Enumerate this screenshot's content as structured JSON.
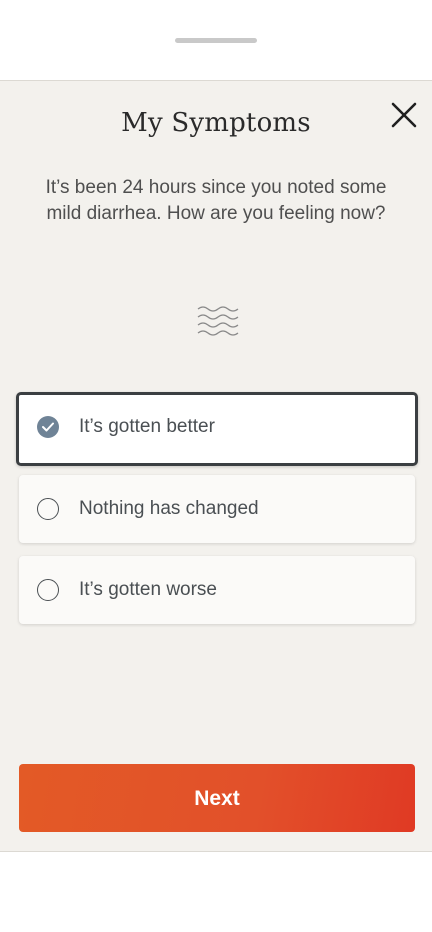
{
  "sheet": {
    "title": "My Symptoms",
    "prompt": "It’s been 24 hours since you noted some mild diarrhea. How are you feeling now?",
    "icon": "diarrhea-waves-icon",
    "close_icon": "close-icon"
  },
  "options": [
    {
      "label": "It’s gotten better",
      "selected": true
    },
    {
      "label": "Nothing has changed",
      "selected": false
    },
    {
      "label": "It’s gotten worse",
      "selected": false
    }
  ],
  "footer": {
    "next_label": "Next"
  },
  "colors": {
    "sheet_background": "#f3f1ed",
    "accent_button": "#e2502a",
    "radio_checked": "#6f8396",
    "selected_border": "#3b3f42"
  }
}
